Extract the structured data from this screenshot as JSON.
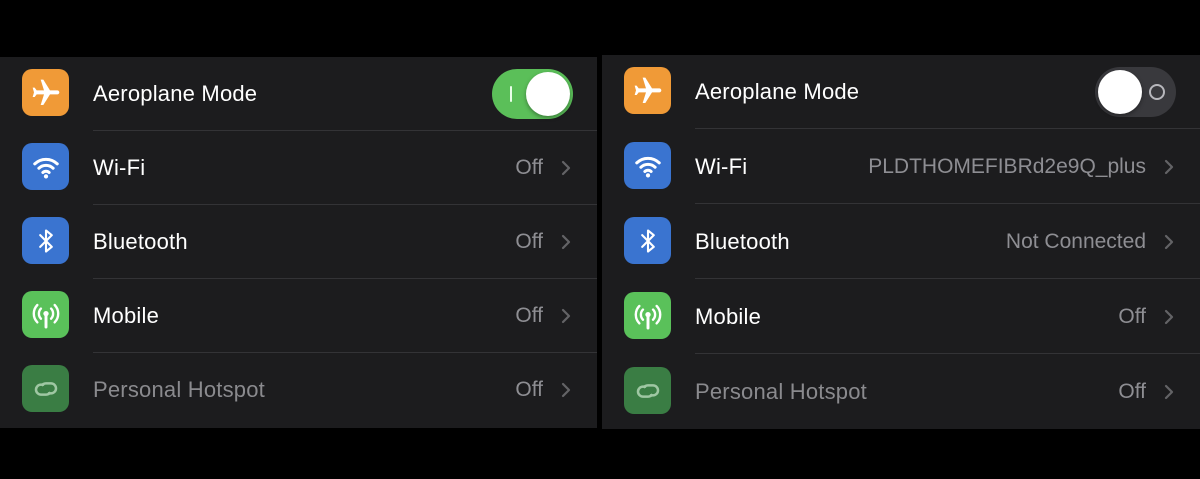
{
  "left": {
    "rows": [
      {
        "label": "Aeroplane Mode",
        "icon": "airplane-icon",
        "toggle": "on"
      },
      {
        "label": "Wi-Fi",
        "icon": "wifi-icon",
        "value": "Off"
      },
      {
        "label": "Bluetooth",
        "icon": "bluetooth-icon",
        "value": "Off"
      },
      {
        "label": "Mobile",
        "icon": "cellular-antenna-icon",
        "value": "Off"
      },
      {
        "label": "Personal Hotspot",
        "icon": "hotspot-link-icon",
        "value": "Off"
      }
    ]
  },
  "right": {
    "rows": [
      {
        "label": "Aeroplane Mode",
        "icon": "airplane-icon",
        "toggle": "off"
      },
      {
        "label": "Wi-Fi",
        "icon": "wifi-icon",
        "value": "PLDTHOMEFIBRd2e9Q_plus"
      },
      {
        "label": "Bluetooth",
        "icon": "bluetooth-icon",
        "value": "Not Connected"
      },
      {
        "label": "Mobile",
        "icon": "cellular-antenna-icon",
        "value": "Off"
      },
      {
        "label": "Personal Hotspot",
        "icon": "hotspot-link-icon",
        "value": "Off"
      }
    ]
  },
  "colors": {
    "airplane": "#f09a37",
    "wifi": "#3a74d0",
    "bluetooth": "#3a74d0",
    "mobile": "#5ac15a",
    "hotspot": "#3a7d44",
    "toggle_on": "#5bbf59",
    "toggle_off": "#39393d"
  }
}
